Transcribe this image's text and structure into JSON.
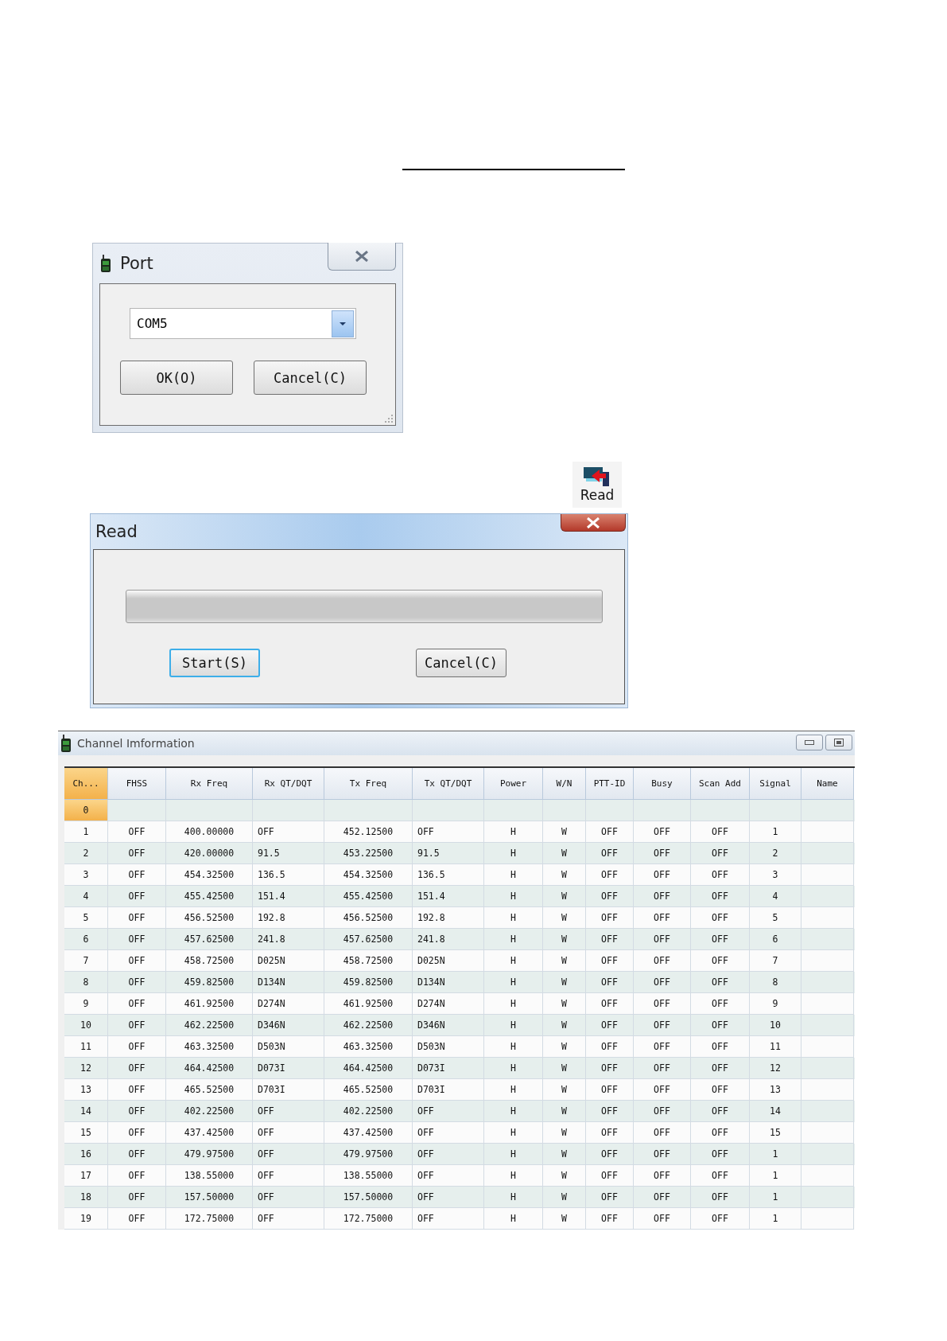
{
  "port_dialog": {
    "title": "Port",
    "port_select": {
      "value": "COM5"
    },
    "buttons": [
      {
        "label": "OK(O)",
        "focused": false
      },
      {
        "label": "Cancel(C)",
        "focused": false
      }
    ]
  },
  "read_toolbar_button": {
    "label": "Read"
  },
  "read_dialog": {
    "title": "Read",
    "progress": {
      "level": 0
    },
    "buttons": [
      {
        "label": "Start(S)",
        "focused": true
      },
      {
        "label": "Cancel(C)",
        "focused": false
      }
    ]
  },
  "channel_window": {
    "title": "Channel Imformation",
    "columns": [
      {
        "label": "Ch...",
        "selected": true
      },
      {
        "label": "FHSS",
        "selected": false
      },
      {
        "label": "Rx Freq",
        "selected": false
      },
      {
        "label": "Rx QT/DQT",
        "selected": false
      },
      {
        "label": "Tx Freq",
        "selected": false
      },
      {
        "label": "Tx QT/DQT",
        "selected": false
      },
      {
        "label": "Power",
        "selected": false
      },
      {
        "label": "W/N",
        "selected": false
      },
      {
        "label": "PTT-ID",
        "selected": false
      },
      {
        "label": "Busy",
        "selected": false
      },
      {
        "label": "Scan Add",
        "selected": false
      },
      {
        "label": "Signal",
        "selected": false
      },
      {
        "label": "Name",
        "selected": false
      }
    ],
    "rows": [
      {
        "selected": true,
        "cells": [
          "0"
        ]
      },
      {
        "selected": false,
        "cells": [
          "1",
          "OFF",
          "400.00000",
          "OFF",
          "452.12500",
          "OFF",
          "H",
          "W",
          "OFF",
          "OFF",
          "OFF",
          "1"
        ]
      },
      {
        "selected": false,
        "cells": [
          "2",
          "OFF",
          "420.00000",
          "91.5",
          "453.22500",
          "91.5",
          "H",
          "W",
          "OFF",
          "OFF",
          "OFF",
          "2"
        ]
      },
      {
        "selected": false,
        "cells": [
          "3",
          "OFF",
          "454.32500",
          "136.5",
          "454.32500",
          "136.5",
          "H",
          "W",
          "OFF",
          "OFF",
          "OFF",
          "3"
        ]
      },
      {
        "selected": false,
        "cells": [
          "4",
          "OFF",
          "455.42500",
          "151.4",
          "455.42500",
          "151.4",
          "H",
          "W",
          "OFF",
          "OFF",
          "OFF",
          "4"
        ]
      },
      {
        "selected": false,
        "cells": [
          "5",
          "OFF",
          "456.52500",
          "192.8",
          "456.52500",
          "192.8",
          "H",
          "W",
          "OFF",
          "OFF",
          "OFF",
          "5"
        ]
      },
      {
        "selected": false,
        "cells": [
          "6",
          "OFF",
          "457.62500",
          "241.8",
          "457.62500",
          "241.8",
          "H",
          "W",
          "OFF",
          "OFF",
          "OFF",
          "6"
        ]
      },
      {
        "selected": false,
        "cells": [
          "7",
          "OFF",
          "458.72500",
          "D025N",
          "458.72500",
          "D025N",
          "H",
          "W",
          "OFF",
          "OFF",
          "OFF",
          "7"
        ]
      },
      {
        "selected": false,
        "cells": [
          "8",
          "OFF",
          "459.82500",
          "D134N",
          "459.82500",
          "D134N",
          "H",
          "W",
          "OFF",
          "OFF",
          "OFF",
          "8"
        ]
      },
      {
        "selected": false,
        "cells": [
          "9",
          "OFF",
          "461.92500",
          "D274N",
          "461.92500",
          "D274N",
          "H",
          "W",
          "OFF",
          "OFF",
          "OFF",
          "9"
        ]
      },
      {
        "selected": false,
        "cells": [
          "10",
          "OFF",
          "462.22500",
          "D346N",
          "462.22500",
          "D346N",
          "H",
          "W",
          "OFF",
          "OFF",
          "OFF",
          "10"
        ]
      },
      {
        "selected": false,
        "cells": [
          "11",
          "OFF",
          "463.32500",
          "D503N",
          "463.32500",
          "D503N",
          "H",
          "W",
          "OFF",
          "OFF",
          "OFF",
          "11"
        ]
      },
      {
        "selected": false,
        "cells": [
          "12",
          "OFF",
          "464.42500",
          "D073I",
          "464.42500",
          "D073I",
          "H",
          "W",
          "OFF",
          "OFF",
          "OFF",
          "12"
        ]
      },
      {
        "selected": false,
        "cells": [
          "13",
          "OFF",
          "465.52500",
          "D703I",
          "465.52500",
          "D703I",
          "H",
          "W",
          "OFF",
          "OFF",
          "OFF",
          "13"
        ]
      },
      {
        "selected": false,
        "cells": [
          "14",
          "OFF",
          "402.22500",
          "OFF",
          "402.22500",
          "OFF",
          "H",
          "W",
          "OFF",
          "OFF",
          "OFF",
          "14"
        ]
      },
      {
        "selected": false,
        "cells": [
          "15",
          "OFF",
          "437.42500",
          "OFF",
          "437.42500",
          "OFF",
          "H",
          "W",
          "OFF",
          "OFF",
          "OFF",
          "15"
        ]
      },
      {
        "selected": false,
        "cells": [
          "16",
          "OFF",
          "479.97500",
          "OFF",
          "479.97500",
          "OFF",
          "H",
          "W",
          "OFF",
          "OFF",
          "OFF",
          "1"
        ]
      },
      {
        "selected": false,
        "cells": [
          "17",
          "OFF",
          "138.55000",
          "OFF",
          "138.55000",
          "OFF",
          "H",
          "W",
          "OFF",
          "OFF",
          "OFF",
          "1"
        ]
      },
      {
        "selected": false,
        "cells": [
          "18",
          "OFF",
          "157.50000",
          "OFF",
          "157.50000",
          "OFF",
          "H",
          "W",
          "OFF",
          "OFF",
          "OFF",
          "1"
        ]
      },
      {
        "selected": false,
        "cells": [
          "19",
          "OFF",
          "172.75000",
          "OFF",
          "172.75000",
          "OFF",
          "H",
          "W",
          "OFF",
          "OFF",
          "OFF",
          "1"
        ]
      }
    ]
  }
}
